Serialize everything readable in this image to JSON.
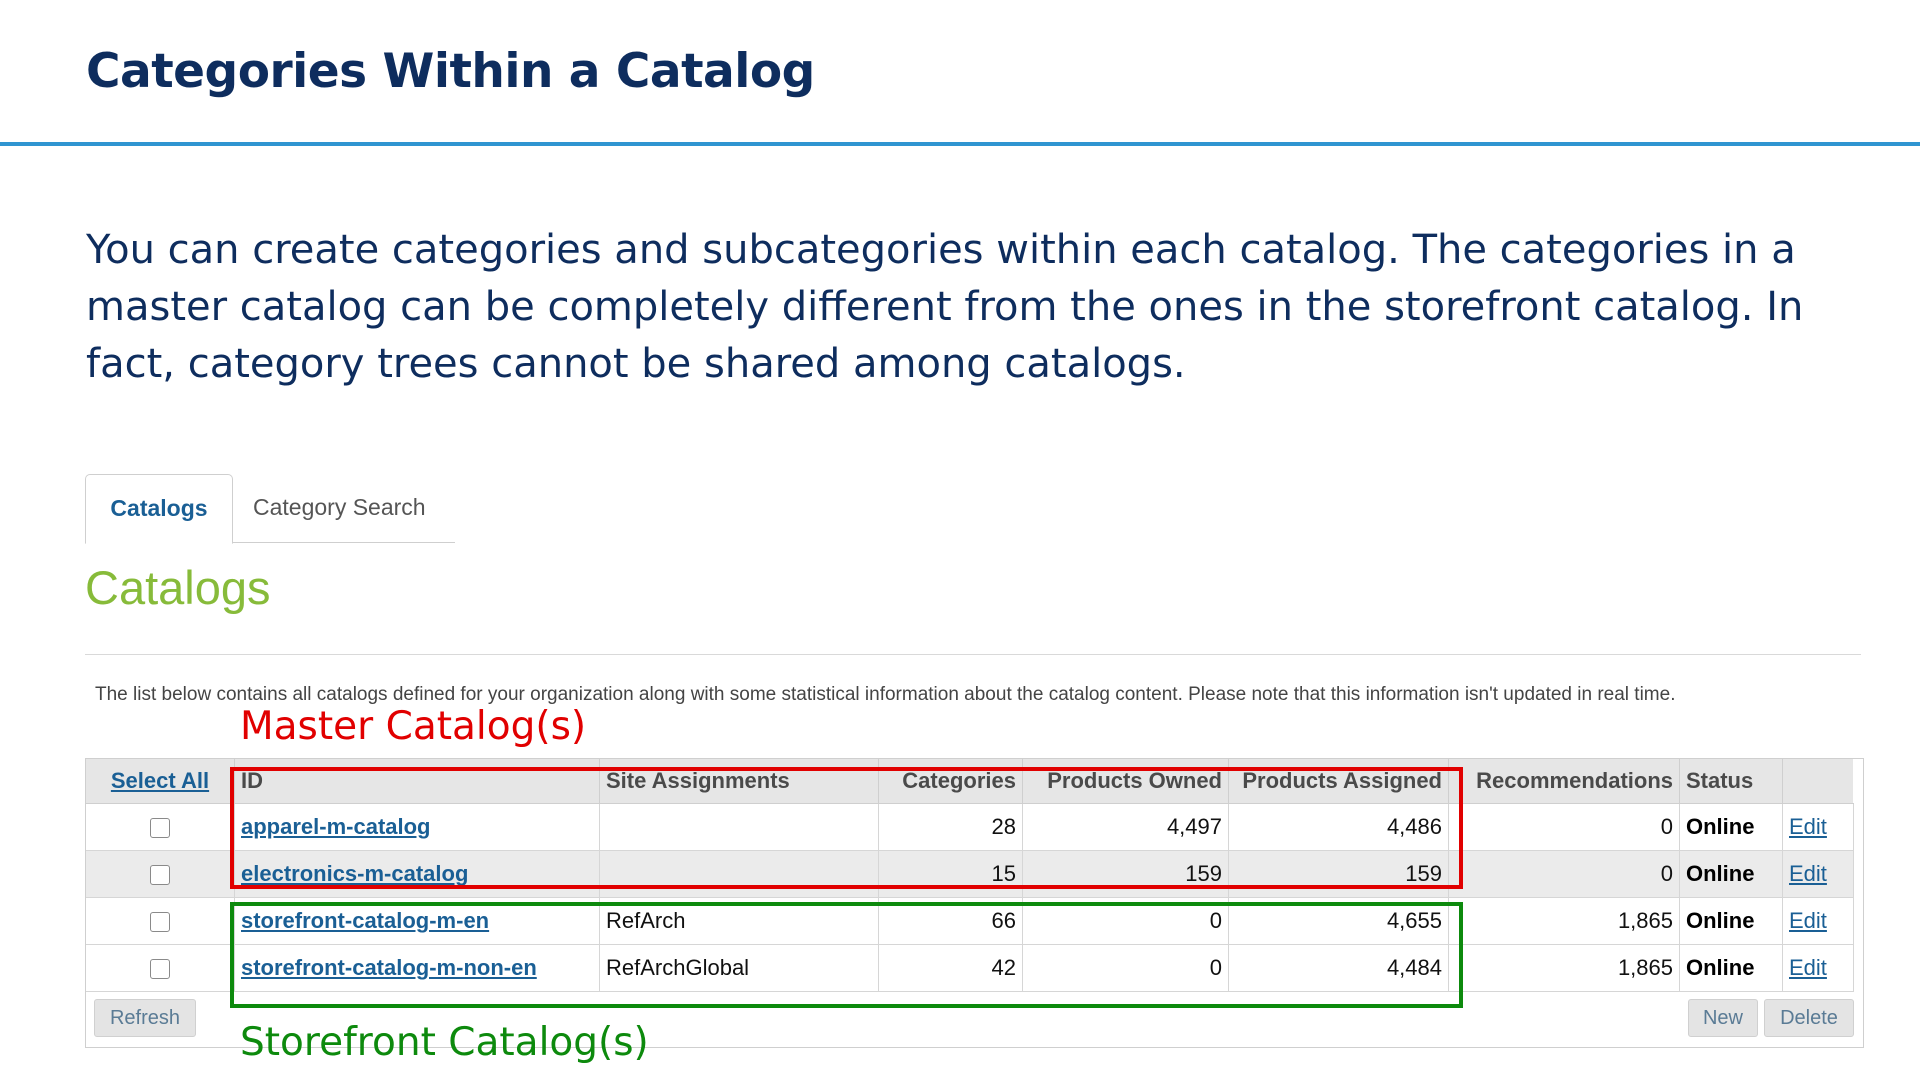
{
  "slide": {
    "title": "Categories Within a Catalog",
    "body": "You can create categories and subcategories within each catalog. The categories in a master catalog can be completely different from the ones in the storefront catalog. In fact, category trees cannot be shared among catalogs."
  },
  "tabs": [
    {
      "label": "Catalogs",
      "active": true
    },
    {
      "label": "Category Search",
      "active": false
    }
  ],
  "section": {
    "heading": "Catalogs",
    "description": "The list below contains all catalogs defined for your organization along with some statistical information about the catalog content. Please note that this information isn't updated in real time."
  },
  "annotations": {
    "master_label": "Master Catalog(s)",
    "storefront_label": "Storefront Catalog(s)",
    "master_color": "#e10000",
    "storefront_color": "#0d8a0d"
  },
  "table": {
    "select_all": "Select All",
    "columns": [
      "ID",
      "Site Assignments",
      "Categories",
      "Products Owned",
      "Products Assigned",
      "Recommendations",
      "Status"
    ],
    "rows": [
      {
        "id": "apparel-m-catalog",
        "site": "",
        "categories": "28",
        "owned": "4,497",
        "assigned": "4,486",
        "recommendations": "0",
        "status": "Online",
        "edit": "Edit"
      },
      {
        "id": "electronics-m-catalog",
        "site": "",
        "categories": "15",
        "owned": "159",
        "assigned": "159",
        "recommendations": "0",
        "status": "Online",
        "edit": "Edit"
      },
      {
        "id": "storefront-catalog-m-en",
        "site": "RefArch",
        "categories": "66",
        "owned": "0",
        "assigned": "4,655",
        "recommendations": "1,865",
        "status": "Online",
        "edit": "Edit"
      },
      {
        "id": "storefront-catalog-m-non-en",
        "site": "RefArchGlobal",
        "categories": "42",
        "owned": "0",
        "assigned": "4,484",
        "recommendations": "1,865",
        "status": "Online",
        "edit": "Edit"
      }
    ]
  },
  "buttons": {
    "refresh": "Refresh",
    "new": "New",
    "delete": "Delete"
  },
  "colors": {
    "title": "#0e2d5e",
    "rule": "#2f95d1",
    "heading": "#87bb3a",
    "link": "#1a5f95"
  }
}
